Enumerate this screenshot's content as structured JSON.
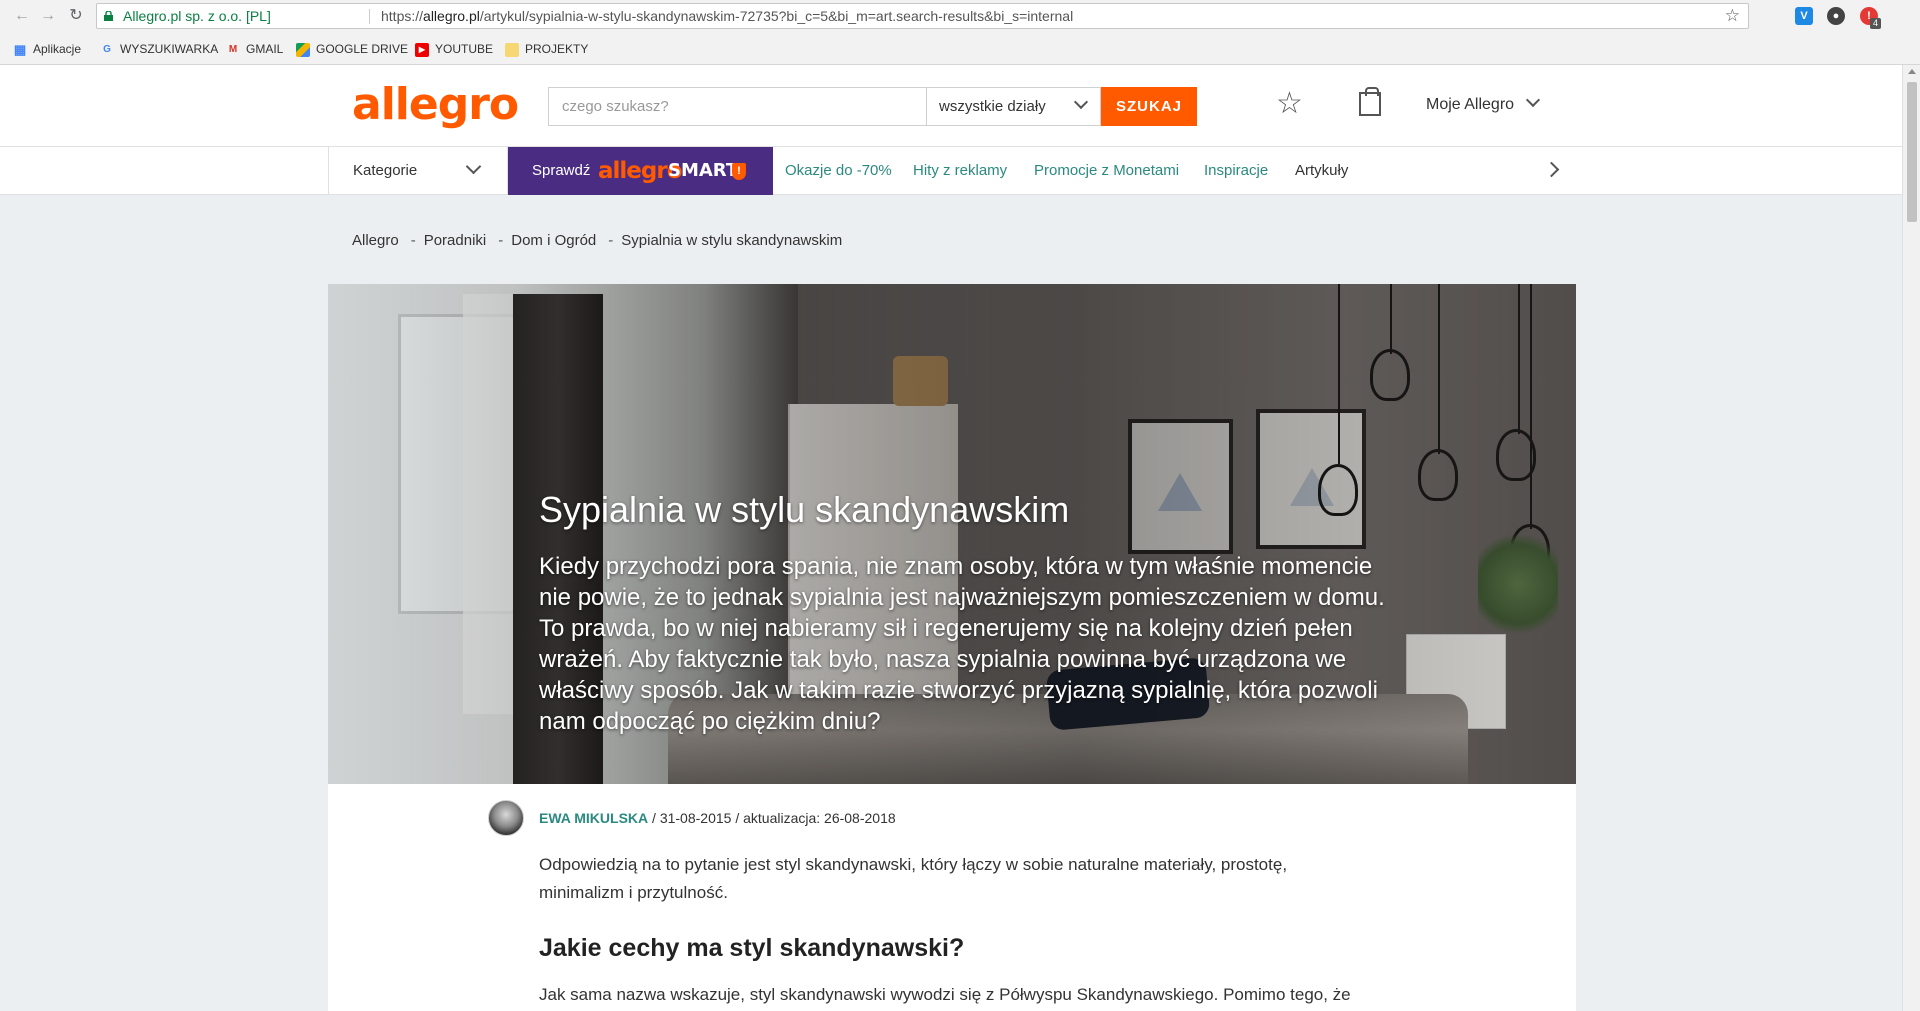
{
  "browser": {
    "url_origin": "Allegro.pl sp. z o.o. [PL]",
    "url_prefix": "https://",
    "url_domain": "allegro.pl",
    "url_path": "/artykul/sypialnia-w-stylu-skandynawskim-72735?bi_c=5&bi_m=art.search-results&bi_s=internal",
    "ext_badge": "4",
    "bookmarks": [
      {
        "label": "Aplikacje",
        "icon": "apps-grid-icon"
      },
      {
        "label": "WYSZUKIWARKA",
        "icon": "google-icon"
      },
      {
        "label": "GMAIL",
        "icon": "gmail-icon"
      },
      {
        "label": "GOOGLE DRIVE",
        "icon": "drive-icon"
      },
      {
        "label": "YOUTUBE",
        "icon": "youtube-icon"
      },
      {
        "label": "PROJEKTY",
        "icon": "folder-icon"
      }
    ]
  },
  "header": {
    "logo": "allegro",
    "search_placeholder": "czego szukasz?",
    "department": "wszystkie działy",
    "search_button": "SZUKAJ",
    "account": "Moje Allegro"
  },
  "nav": {
    "categories": "Kategorie",
    "smart_prefix": "Sprawdź",
    "smart_brand": "allegro",
    "smart_suffix": "SMART",
    "smart_badge": "!",
    "links": [
      "Okazje do -70%",
      "Hity z reklamy",
      "Promocje z Monetami",
      "Inspiracje",
      "Artykuły"
    ]
  },
  "breadcrumb": [
    "Allegro",
    "Poradniki",
    "Dom i Ogród",
    "Sypialnia w stylu skandynawskim"
  ],
  "hero": {
    "title": "Sypialnia w stylu skandynawskim",
    "lead": "Kiedy przychodzi pora spania, nie znam osoby, która w tym właśnie momencie nie powie, że to jednak sypialnia jest najważniejszym pomieszczeniem w domu. To prawda, bo w niej nabieramy sił i regenerujemy się na kolejny dzień pełen wrażeń. Aby faktycznie tak było, nasza sypialnia powinna być urządzona we właściwy sposób. Jak w takim razie stworzyć przyjazną sypialnię, która pozwoli nam odpocząć po ciężkim dniu?"
  },
  "article": {
    "author": "EWA MIKULSKA",
    "date": "/ 31-08-2015 / aktualizacja: 26-08-2018",
    "intro": "Odpowiedzią na to pytanie jest styl skandynawski, który łączy w sobie naturalne materiały, prostotę, minimalizm i przytulność.",
    "heading": "Jakie cechy ma styl skandynawski?",
    "para": "Jak sama nazwa wskazuje, styl skandynawski wywodzi się z Półwyspu Skandynawskiego. Pomimo tego, że"
  },
  "colors": {
    "brand": "#ff5a00",
    "smart_bg": "#4a2d82",
    "link": "#2b8a80"
  }
}
